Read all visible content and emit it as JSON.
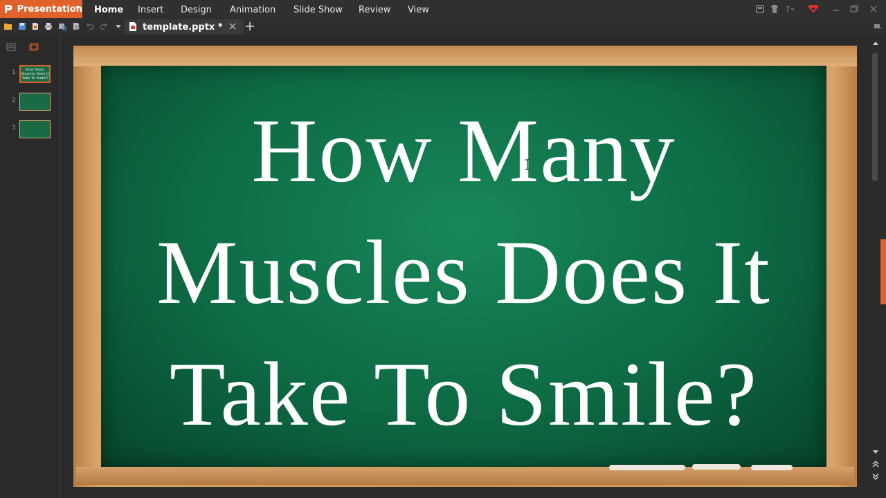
{
  "app": {
    "name": "Presentation",
    "accent_color": "#e0622a"
  },
  "menu": {
    "items": [
      "Home",
      "Insert",
      "Design",
      "Animation",
      "Slide Show",
      "Review",
      "View"
    ],
    "active": "Home"
  },
  "document": {
    "tab_label": "template.pptx *"
  },
  "slides": {
    "count": 3,
    "selected": 1,
    "thumbnails": [
      {
        "number": "1",
        "text": "How Many Muscles Does It Take To Smile?"
      },
      {
        "number": "2",
        "text": ""
      },
      {
        "number": "3",
        "text": ""
      }
    ]
  },
  "current_slide": {
    "title_lines": [
      "How Many",
      "Muscles Does It",
      "Take To Smile?"
    ],
    "board_color": "#0f7048",
    "frame_color": "#c99156"
  },
  "icons": {
    "app_logo": "presentation-logo-icon",
    "toolbar": [
      "open-folder-icon",
      "save-icon",
      "new-icon",
      "print-icon",
      "print-preview-icon",
      "export-pdf-icon",
      "undo-icon",
      "redo-icon",
      "dropdown-icon"
    ],
    "window": [
      "skin-icon",
      "shirt-icon",
      "help-icon",
      "heart-icon",
      "minimize-icon",
      "restore-icon",
      "close-icon"
    ]
  }
}
